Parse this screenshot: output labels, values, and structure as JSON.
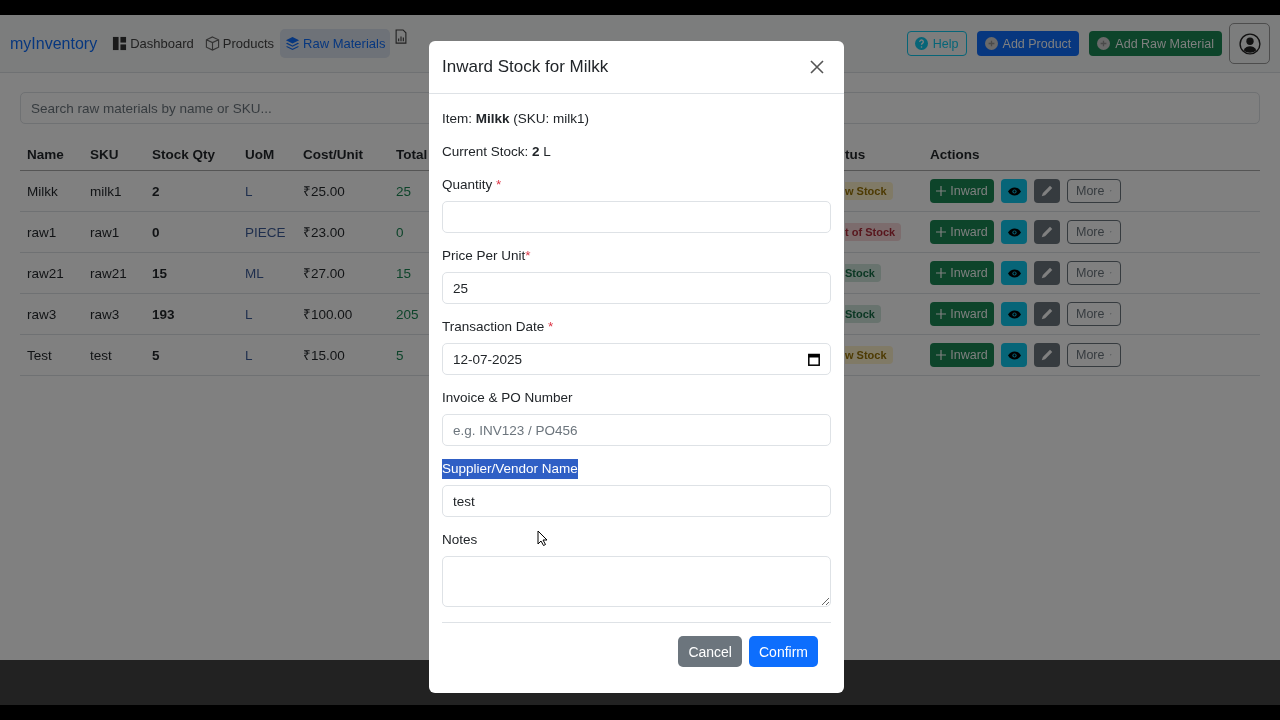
{
  "navbar": {
    "brand": "myInventory",
    "links": [
      {
        "kind": "link",
        "label": "Dashboard",
        "selected": false
      },
      {
        "kind": "link",
        "label": "Products",
        "selected": false
      },
      {
        "kind": "link",
        "label": "Raw Materials",
        "selected": true
      },
      {
        "kind": "cut",
        "selected": false
      }
    ],
    "buttons": [
      {
        "kind": "outline-info",
        "label": "Help"
      },
      {
        "kind": "primary",
        "label": "Add Product"
      },
      {
        "kind": "success",
        "label": "Add Raw Material"
      }
    ]
  },
  "search": {
    "placeholder": "Search raw materials by name or SKU..."
  },
  "table": {
    "columns": [
      "Name",
      "SKU",
      "Stock Qty",
      "UoM",
      "Cost/Unit",
      "Total",
      "tus",
      "Actions"
    ],
    "rows": [
      {
        "cells": [
          "Milkk",
          "milk1",
          "2",
          "L",
          "₹25.00",
          "25"
        ],
        "status": {
          "text": "w Stock",
          "color": "#807a66"
        },
        "actions": [
          "Inward",
          "More"
        ]
      },
      {
        "cells": [
          "raw1",
          "raw1",
          "0",
          "PIECE",
          "₹23.00",
          "0"
        ],
        "status": {
          "text": "t of Stock",
          "color": "#7c6c6d"
        },
        "actions": [
          "Inward",
          "More"
        ]
      },
      {
        "cells": [
          "raw21",
          "raw21",
          "15",
          "ML",
          "₹27.00",
          "15"
        ],
        "status": {
          "text": "Stock",
          "color": "#68736e"
        },
        "actions": [
          "Inward",
          "More"
        ]
      },
      {
        "cells": [
          "raw3",
          "raw3",
          "193",
          "L",
          "₹100.00",
          "205"
        ],
        "status": {
          "text": "Stock",
          "color": "#68736e"
        },
        "actions": [
          "Inward",
          "More"
        ]
      },
      {
        "cells": [
          "Test",
          "test",
          "5",
          "L",
          "₹15.00",
          "5"
        ],
        "status": {
          "text": "w Stock",
          "color": "#807a66"
        },
        "actions": [
          "Inward",
          "More"
        ]
      }
    ]
  },
  "modal": {
    "title": "Inward Stock for Milkk",
    "info": [
      "Item: **Milkk** (SKU: milk1)",
      "Current Stock: **2** L"
    ],
    "fields": [
      {
        "kind": "text",
        "label": "Quantity",
        "required_mark": " *",
        "highlighted": false
      },
      {
        "kind": "text",
        "label": "Price Per Unit",
        "required_mark": "*",
        "value": "25",
        "highlighted": false
      },
      {
        "kind": "date",
        "label": "Transaction Date",
        "required_mark": " *",
        "value": "12-07-2025",
        "highlighted": false
      },
      {
        "kind": "text",
        "label": "Invoice & PO Number",
        "placeholder": "e.g. INV123 / PO456",
        "highlighted": false
      },
      {
        "kind": "text",
        "label": "Supplier/Vendor Name",
        "value": "test",
        "highlighted": true
      },
      {
        "kind": "textarea",
        "label": "Notes",
        "highlighted": false
      }
    ],
    "buttons": [
      {
        "kind": "secondary",
        "label": "Cancel"
      },
      {
        "kind": "primary",
        "label": "Confirm"
      }
    ]
  }
}
